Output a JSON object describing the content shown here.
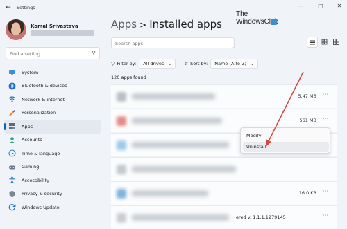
{
  "window": {
    "title": "Settings"
  },
  "profile": {
    "name": "Komal Srivastava"
  },
  "sidebar": {
    "search_placeholder": "Find a setting",
    "items": [
      {
        "label": "System",
        "icon": "monitor-icon"
      },
      {
        "label": "Bluetooth & devices",
        "icon": "bluetooth-icon"
      },
      {
        "label": "Network & internet",
        "icon": "wifi-icon"
      },
      {
        "label": "Personalization",
        "icon": "brush-icon"
      },
      {
        "label": "Apps",
        "icon": "apps-icon",
        "active": true
      },
      {
        "label": "Accounts",
        "icon": "person-icon"
      },
      {
        "label": "Time & language",
        "icon": "globe-clock-icon"
      },
      {
        "label": "Gaming",
        "icon": "gamepad-icon"
      },
      {
        "label": "Accessibility",
        "icon": "accessibility-icon"
      },
      {
        "label": "Privacy & security",
        "icon": "shield-icon"
      },
      {
        "label": "Windows Update",
        "icon": "update-icon"
      }
    ]
  },
  "header": {
    "breadcrumb_parent": "Apps",
    "separator": ">",
    "title": "Installed apps"
  },
  "watermark": {
    "line1": "The",
    "line2": "WindowsClub"
  },
  "search": {
    "placeholder": "Search apps"
  },
  "filters": {
    "filter_label": "Filter by:",
    "filter_value": "All drives",
    "sort_label": "Sort by:",
    "sort_value": "Name (A to Z)"
  },
  "apps_found": "120 apps found",
  "rows": [
    {
      "size": "5.47 MB",
      "title": ""
    },
    {
      "size": "561 MB",
      "title": ""
    },
    {
      "size": "",
      "title": ""
    },
    {
      "size": "",
      "title": ""
    },
    {
      "size": "16.0 KB",
      "title": ""
    },
    {
      "size": "",
      "title": "ered v. 1.1.1.1279145"
    }
  ],
  "context_menu": {
    "items": [
      "Modify",
      "Uninstall"
    ]
  },
  "colors": {
    "accent": "#0067c0",
    "annotation_arrow": "#d9463f"
  }
}
